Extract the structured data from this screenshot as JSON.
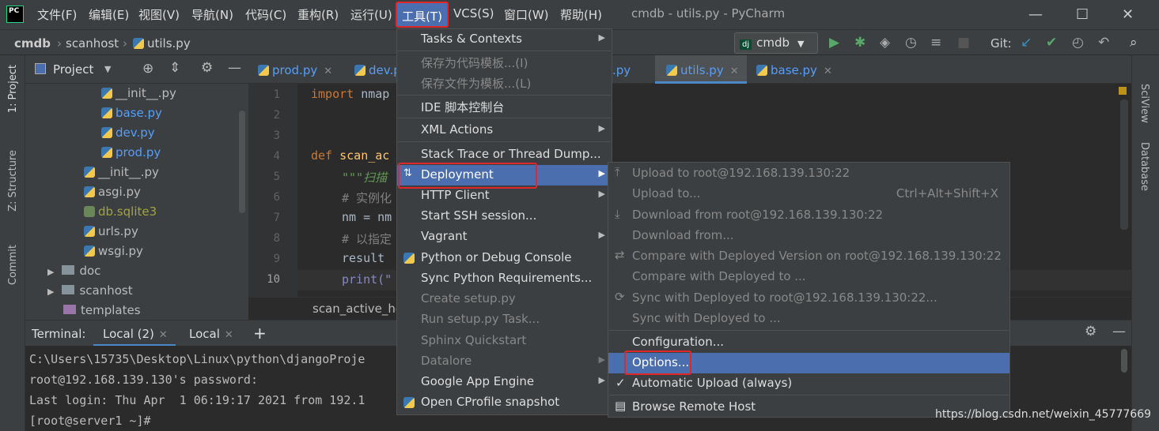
{
  "menubar": {
    "app_icon": "PC",
    "items": [
      "文件(F)",
      "编辑(E)",
      "视图(V)",
      "导航(N)",
      "代码(C)",
      "重构(R)",
      "运行(U)",
      "工具(T)",
      "VCS(S)",
      "窗口(W)",
      "帮助(H)"
    ],
    "title": "cmdb - utils.py - PyCharm"
  },
  "navbar": {
    "crumbs": [
      "cmdb",
      "scanhost",
      "utils.py"
    ],
    "run_config": "cmdb",
    "git_label": "Git:"
  },
  "left_tabs": [
    "1: Project",
    "Z: Structure",
    "Commit"
  ],
  "right_tabs": [
    "SciView",
    "Database"
  ],
  "project": {
    "title": "Project",
    "items": [
      "__init__.py",
      "base.py",
      "dev.py",
      "prod.py",
      "__init__.py",
      "asgi.py",
      "db.sqlite3",
      "urls.py",
      "wsgi.py",
      "doc",
      "scanhost",
      "templates"
    ]
  },
  "tabs": [
    "prod.py",
    "dev.py",
    ".py",
    "utils.py",
    "base.py"
  ],
  "code": {
    "line_numbers": [
      "1",
      "2",
      "3",
      "4",
      "5",
      "6",
      "7",
      "8",
      "9",
      "10"
    ],
    "l1_kw": "import",
    "l1_rest": " nmap",
    "l4_kw": "def",
    "l4_rest": " scan_ac",
    "l5": "\"\"\"扫描",
    "l6": "# 实例化",
    "l7": "nm = nm",
    "l8": "# 以指定",
    "l9": "result",
    "l10": "print(\""
  },
  "editor_breadcrumb": "scan_active_ho",
  "terminal": {
    "label": "Terminal:",
    "tabs": [
      "Local (2)",
      "Local"
    ],
    "add": "+",
    "lines": [
      "C:\\Users\\15735\\Desktop\\Linux\\python\\djangoProje",
      "root@192.168.139.130's password:",
      "Last login: Thu Apr  1 06:19:17 2021 from 192.1",
      "[root@server1 ~]#"
    ]
  },
  "tools_menu": [
    {
      "label": "Tasks & Contexts",
      "sub": true,
      "dis": false
    },
    {
      "label": "保存为代码模板...(I)",
      "sub": false,
      "dis": true
    },
    {
      "label": "保存文件为模板...(L)",
      "sub": false,
      "dis": true
    },
    {
      "label": "IDE 脚本控制台",
      "sub": false,
      "dis": false
    },
    {
      "label": "XML Actions",
      "sub": true,
      "dis": false
    },
    {
      "label": "Stack Trace or Thread Dump...",
      "sub": false,
      "dis": false
    },
    {
      "label": "Deployment",
      "sub": true,
      "dis": false,
      "sel": true
    },
    {
      "label": "HTTP Client",
      "sub": true,
      "dis": false
    },
    {
      "label": "Start SSH session...",
      "sub": false,
      "dis": false
    },
    {
      "label": "Vagrant",
      "sub": true,
      "dis": false
    },
    {
      "label": "Python or Debug Console",
      "sub": false,
      "dis": false
    },
    {
      "label": "Sync Python Requirements...",
      "sub": false,
      "dis": false
    },
    {
      "label": "Create setup.py",
      "sub": false,
      "dis": true
    },
    {
      "label": "Run setup.py Task...",
      "sub": false,
      "dis": true
    },
    {
      "label": "Sphinx Quickstart",
      "sub": false,
      "dis": true
    },
    {
      "label": "Datalore",
      "sub": true,
      "dis": true
    },
    {
      "label": "Google App Engine",
      "sub": true,
      "dis": false
    },
    {
      "label": "Open CProfile snapshot",
      "sub": false,
      "dis": false
    }
  ],
  "deploy_menu": [
    {
      "label": "Upload to root@192.168.139.130:22",
      "en": false
    },
    {
      "label": "Upload to...",
      "en": false,
      "shortcut": "Ctrl+Alt+Shift+X"
    },
    {
      "label": "Download from root@192.168.139.130:22",
      "en": false
    },
    {
      "label": "Download from...",
      "en": false
    },
    {
      "label": "Compare with Deployed Version on root@192.168.139.130:22",
      "en": false
    },
    {
      "label": "Compare with Deployed to ...",
      "en": false
    },
    {
      "label": "Sync with Deployed to root@192.168.139.130:22...",
      "en": false
    },
    {
      "label": "Sync with Deployed to ...",
      "en": false
    },
    {
      "label": "Configuration...",
      "en": true
    },
    {
      "label": "Options...",
      "en": true,
      "sel": true
    },
    {
      "label": "Automatic Upload (always)",
      "en": true,
      "check": "✓"
    },
    {
      "label": "Browse Remote Host",
      "en": true
    }
  ],
  "watermark": "https://blog.csdn.net/weixin_45777669",
  "colors": {
    "accent": "#4b6eaf",
    "highlight": "#e0282a",
    "bg": "#2b2b2b",
    "panel": "#3c3f41"
  }
}
